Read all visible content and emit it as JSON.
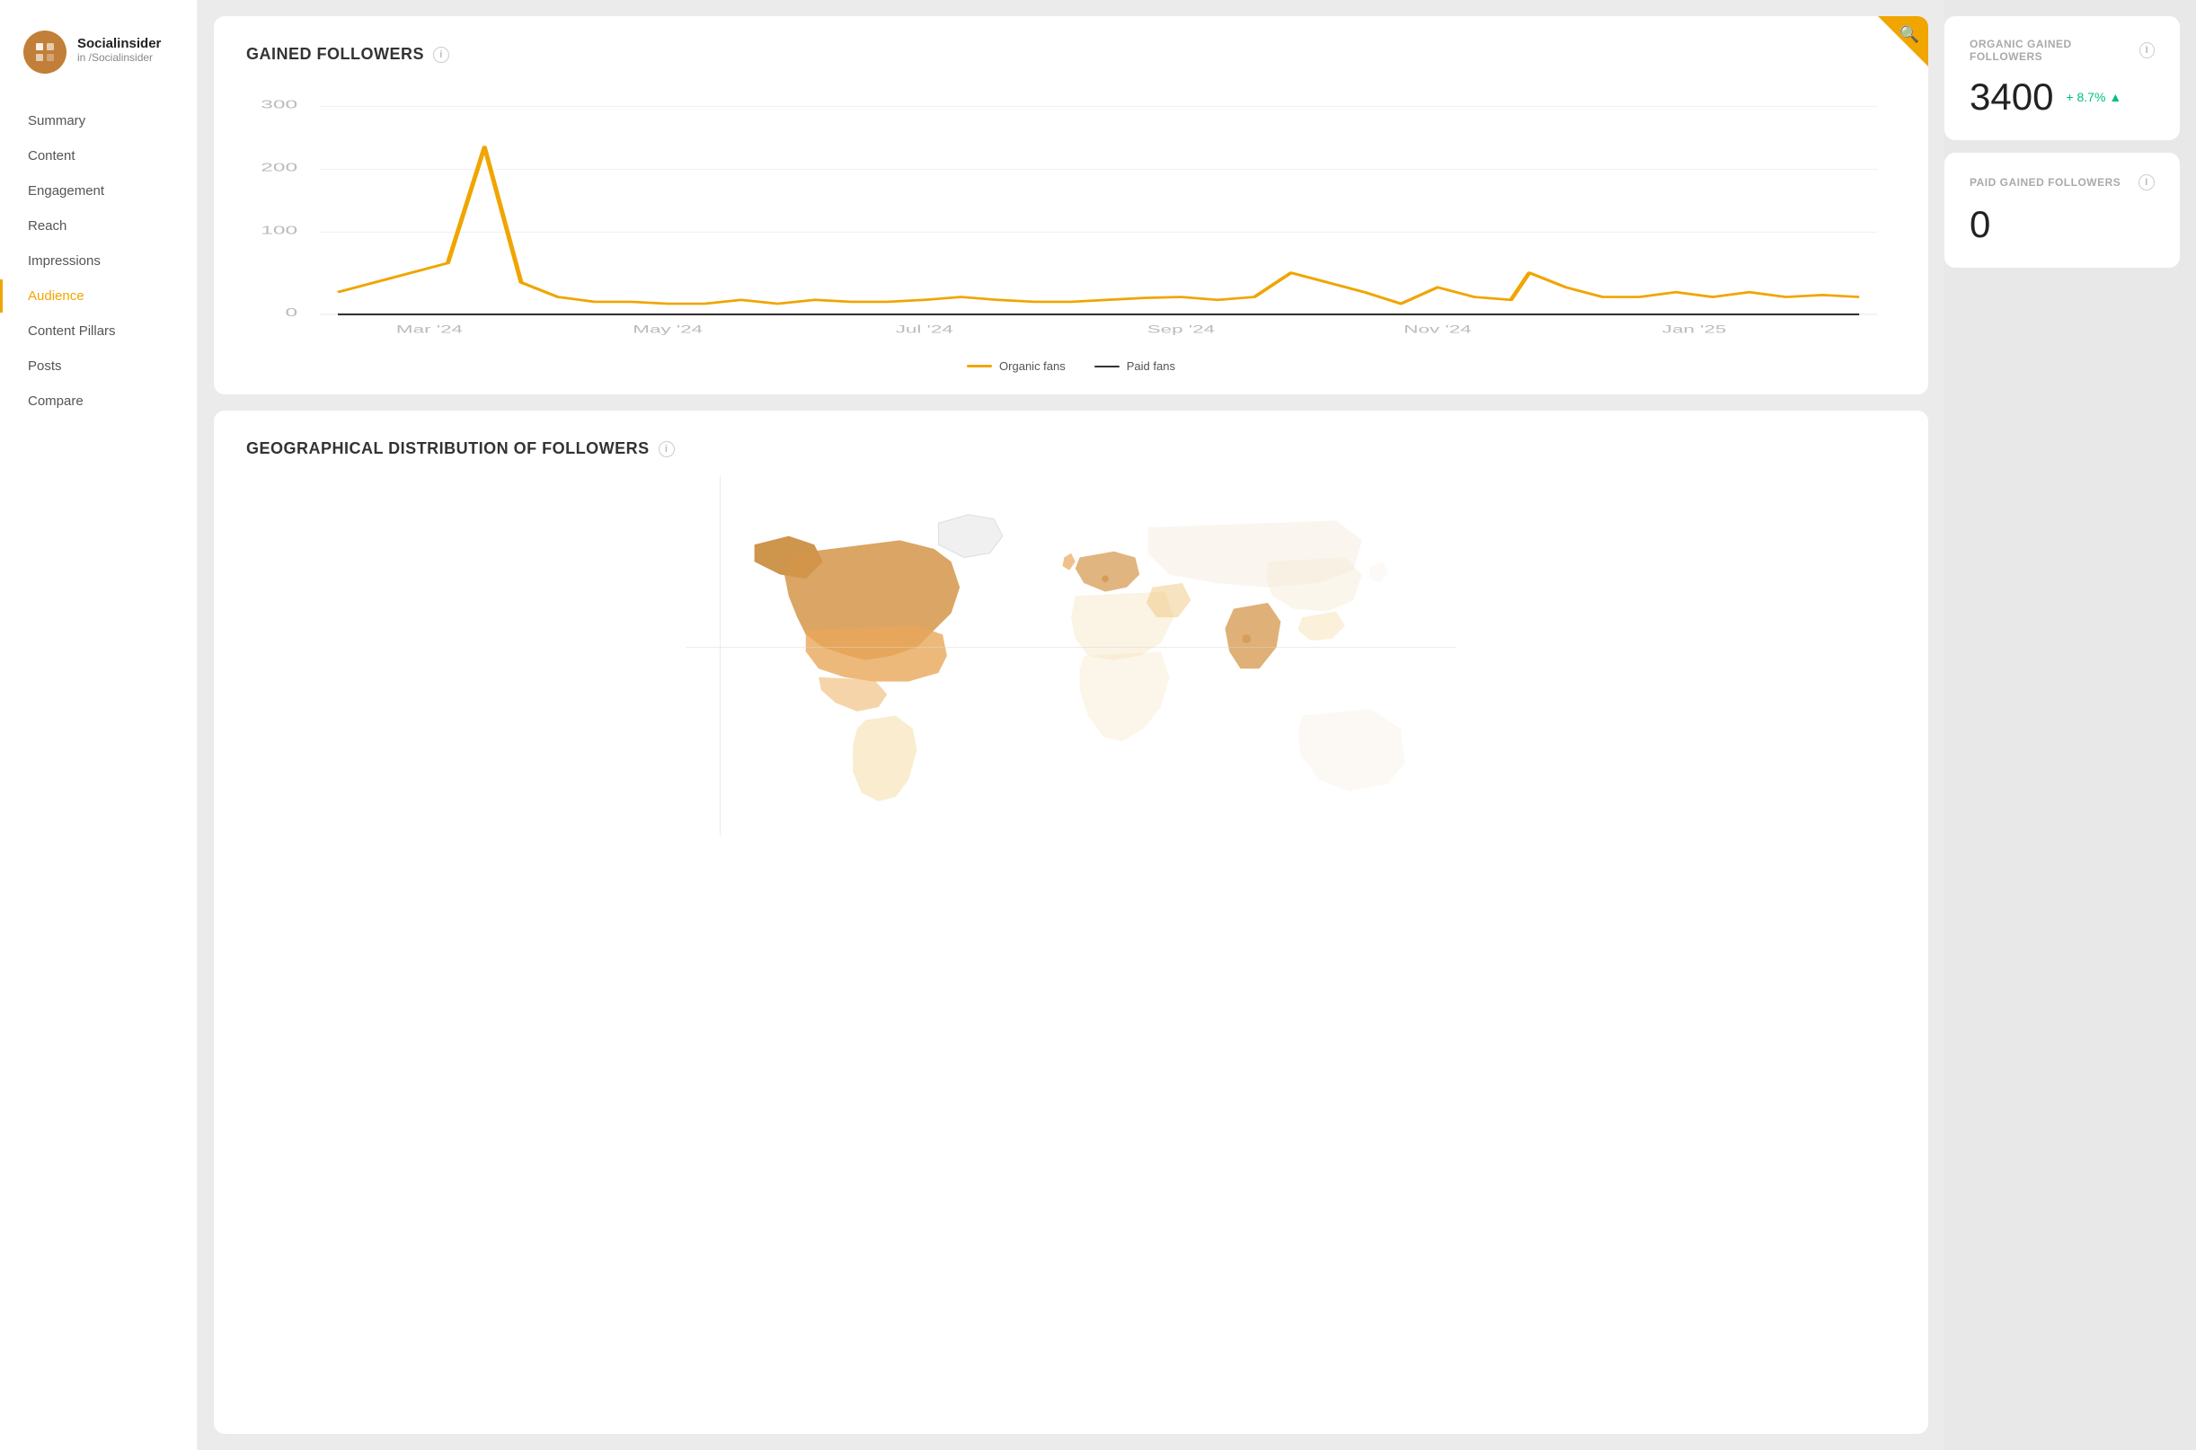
{
  "sidebar": {
    "brand": {
      "name": "Socialinsider",
      "handle": "in /Socialinsider",
      "platform": "in"
    },
    "nav_items": [
      {
        "id": "summary",
        "label": "Summary",
        "active": false
      },
      {
        "id": "content",
        "label": "Content",
        "active": false
      },
      {
        "id": "engagement",
        "label": "Engagement",
        "active": false
      },
      {
        "id": "reach",
        "label": "Reach",
        "active": false
      },
      {
        "id": "impressions",
        "label": "Impressions",
        "active": false
      },
      {
        "id": "audience",
        "label": "Audience",
        "active": true
      },
      {
        "id": "content-pillars",
        "label": "Content Pillars",
        "active": false
      },
      {
        "id": "posts",
        "label": "Posts",
        "active": false
      },
      {
        "id": "compare",
        "label": "Compare",
        "active": false
      }
    ]
  },
  "gained_followers": {
    "title": "GAINED FOLLOWERS",
    "legend": {
      "organic": "Organic fans",
      "paid": "Paid fans"
    }
  },
  "organic_gained": {
    "title": "ORGANIC GAINED FOLLOWERS",
    "value": "3400",
    "change": "+ 8.7%"
  },
  "paid_gained": {
    "title": "PAID GAINED FOLLOWERS",
    "value": "0"
  },
  "geo_distribution": {
    "title": "GEOGRAPHICAL DISTRIBUTION OF FOLLOWERS"
  },
  "info_icon_label": "i"
}
